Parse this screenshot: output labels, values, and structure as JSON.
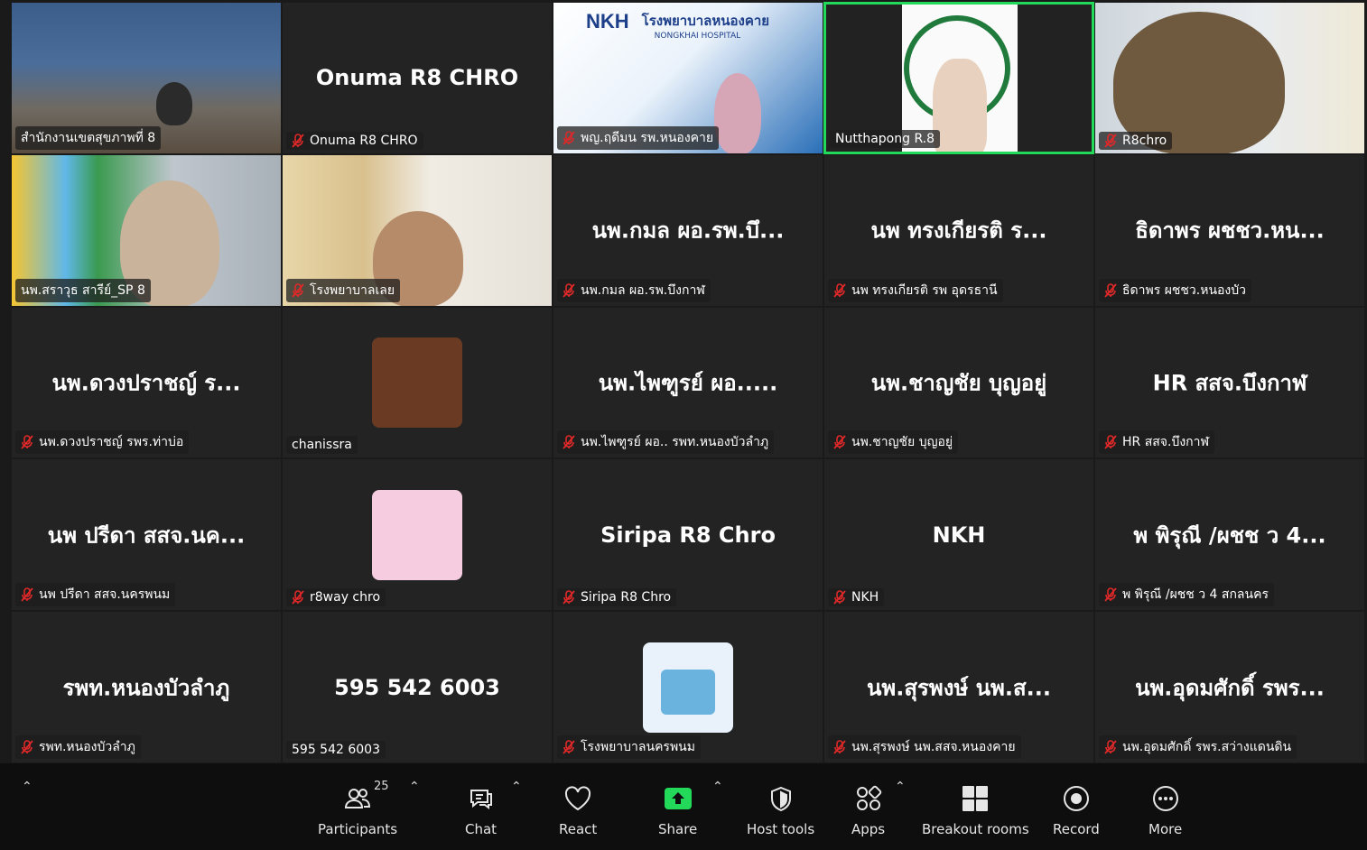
{
  "participants": [
    {
      "display": "",
      "label": "สำนักงานเขตสุขภาพที่ 8",
      "muted": false,
      "video": "vid1"
    },
    {
      "display": "Onuma R8 CHRO",
      "label": "Onuma R8 CHRO",
      "muted": true,
      "video": ""
    },
    {
      "display": "",
      "label": "พญ.ฤดีมน รพ.หนองคาย",
      "muted": true,
      "video": "vid3",
      "banner_logo": "NKH",
      "banner_title": "โรงพยาบาลหนองคาย",
      "banner_sub": "NONGKHAI HOSPITAL"
    },
    {
      "display": "",
      "label": "Nutthapong R.8",
      "muted": false,
      "video": "vid4",
      "active": true
    },
    {
      "display": "",
      "label": "R8chro",
      "muted": true,
      "video": "vid5"
    },
    {
      "display": "",
      "label": "นพ.สราวุธ สารีย์_SP 8",
      "muted": false,
      "video": "vid6"
    },
    {
      "display": "",
      "label": "โรงพยาบาลเลย",
      "muted": true,
      "video": "vid7"
    },
    {
      "display": "นพ.กมล ผอ.รพ.บึ...",
      "label": "นพ.กมล ผอ.รพ.บึงกาฬ",
      "muted": true,
      "video": ""
    },
    {
      "display": "นพ ทรงเกียรติ  ร...",
      "label": "นพ ทรงเกียรติ  รพ อุดรธานี",
      "muted": true,
      "video": ""
    },
    {
      "display": "ธิดาพร ผชชว.หน...",
      "label": "ธิดาพร ผชชว.หนองบัว",
      "muted": true,
      "video": ""
    },
    {
      "display": "นพ.ดวงปราชญ์ ร...",
      "label": "นพ.ดวงปราชญ์ รพร.ท่าบ่อ",
      "muted": true,
      "video": ""
    },
    {
      "display": "",
      "label": "chanissra",
      "muted": false,
      "video": "",
      "avatar": "#6b3a22"
    },
    {
      "display": "นพ.ไพฑูรย์ ผอ.....",
      "label": "นพ.ไพฑูรย์ ผอ.. รพท.หนองบัวลำภู",
      "muted": true,
      "video": ""
    },
    {
      "display": "นพ.ชาญชัย  บุญอยู่",
      "label": "นพ.ชาญชัย  บุญอยู่",
      "muted": true,
      "video": ""
    },
    {
      "display": "HR สสจ.บึงกาฬ",
      "label": "HR สสจ.บึงกาฬ",
      "muted": true,
      "video": ""
    },
    {
      "display": "นพ ปรีดา สสจ.นค...",
      "label": "นพ ปรีดา สสจ.นครพนม",
      "muted": true,
      "video": ""
    },
    {
      "display": "",
      "label": "r8way chro",
      "muted": true,
      "video": "",
      "avatar": "#f6cde0"
    },
    {
      "display": "Siripa R8 Chro",
      "label": "Siripa R8 Chro",
      "muted": true,
      "video": ""
    },
    {
      "display": "NKH",
      "label": "NKH",
      "muted": true,
      "video": ""
    },
    {
      "display": "พ พิรุณี /ผชช ว 4...",
      "label": "พ พิรุณี /ผชช ว 4 สกลนคร",
      "muted": true,
      "video": ""
    },
    {
      "display": "รพท.หนองบัวลำภู",
      "label": "รพท.หนองบัวลำภู",
      "muted": true,
      "video": ""
    },
    {
      "display": "595 542 6003",
      "label": "595 542 6003",
      "muted": false,
      "video": ""
    },
    {
      "display": "",
      "label": "โรงพยาบาลนครพนม",
      "muted": true,
      "video": "",
      "avatar": "#e9f2fa"
    },
    {
      "display": "นพ.สุรพงษ์ นพ.ส...",
      "label": "นพ.สุรพงษ์ นพ.สสจ.หนองคาย",
      "muted": true,
      "video": ""
    },
    {
      "display": "นพ.อุดมศักดิ์ รพร...",
      "label": "นพ.อุดมศักดิ์ รพร.สว่างแดนดิน",
      "muted": true,
      "video": ""
    }
  ],
  "toolbar": {
    "participants_label": "Participants",
    "participants_count": "25",
    "chat_label": "Chat",
    "react_label": "React",
    "share_label": "Share",
    "host_tools_label": "Host tools",
    "apps_label": "Apps",
    "breakout_label": "Breakout rooms",
    "record_label": "Record",
    "more_label": "More"
  },
  "colors": {
    "active_speaker": "#23d959",
    "share_green": "#23d959",
    "mute_red": "#e02828"
  }
}
